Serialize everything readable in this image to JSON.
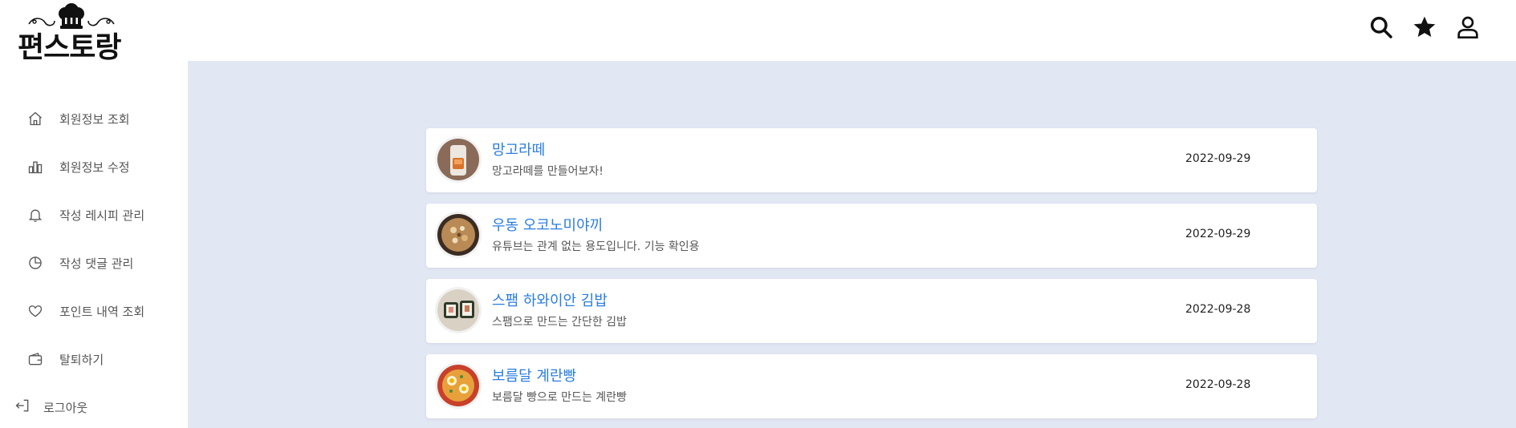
{
  "brand": {
    "logo_text": "편스토랑",
    "logo_icon": "chef-hat-icon"
  },
  "sidebar": {
    "items": [
      {
        "label": "회원정보 조회",
        "icon": "home-icon"
      },
      {
        "label": "회원정보 수정",
        "icon": "bar-chart-icon"
      },
      {
        "label": "작성 레시피 관리",
        "icon": "bell-icon"
      },
      {
        "label": "작성 댓글 관리",
        "icon": "pie-chart-icon"
      },
      {
        "label": "포인트 내역 조회",
        "icon": "heart-icon"
      },
      {
        "label": "탈퇴하기",
        "icon": "wallet-icon"
      }
    ],
    "logout": {
      "label": "로그아웃",
      "icon": "logout-icon"
    }
  },
  "header": {
    "icons": [
      "search-icon",
      "star-icon",
      "user-icon"
    ]
  },
  "recipes": [
    {
      "title": "망고라떼",
      "description": "망고라떼를 만들어보자!",
      "date": "2022-09-29",
      "thumb": "mango-latte-thumbnail"
    },
    {
      "title": "우동 오코노미야끼",
      "description": "유튜브는 관계 없는 용도입니다. 기능 확인용",
      "date": "2022-09-29",
      "thumb": "okonomiyaki-thumbnail"
    },
    {
      "title": "스팸 하와이안 김밥",
      "description": "스팸으로 만드는 간단한 김밥",
      "date": "2022-09-28",
      "thumb": "spam-kimbap-thumbnail"
    },
    {
      "title": "보름달 계란빵",
      "description": "보름달 빵으로 만드는 계란빵",
      "date": "2022-09-28",
      "thumb": "egg-bread-thumbnail"
    }
  ],
  "colors": {
    "accent": "#2a7de1",
    "main_bg": "#e2e7f4",
    "card_bg": "#ffffff"
  }
}
